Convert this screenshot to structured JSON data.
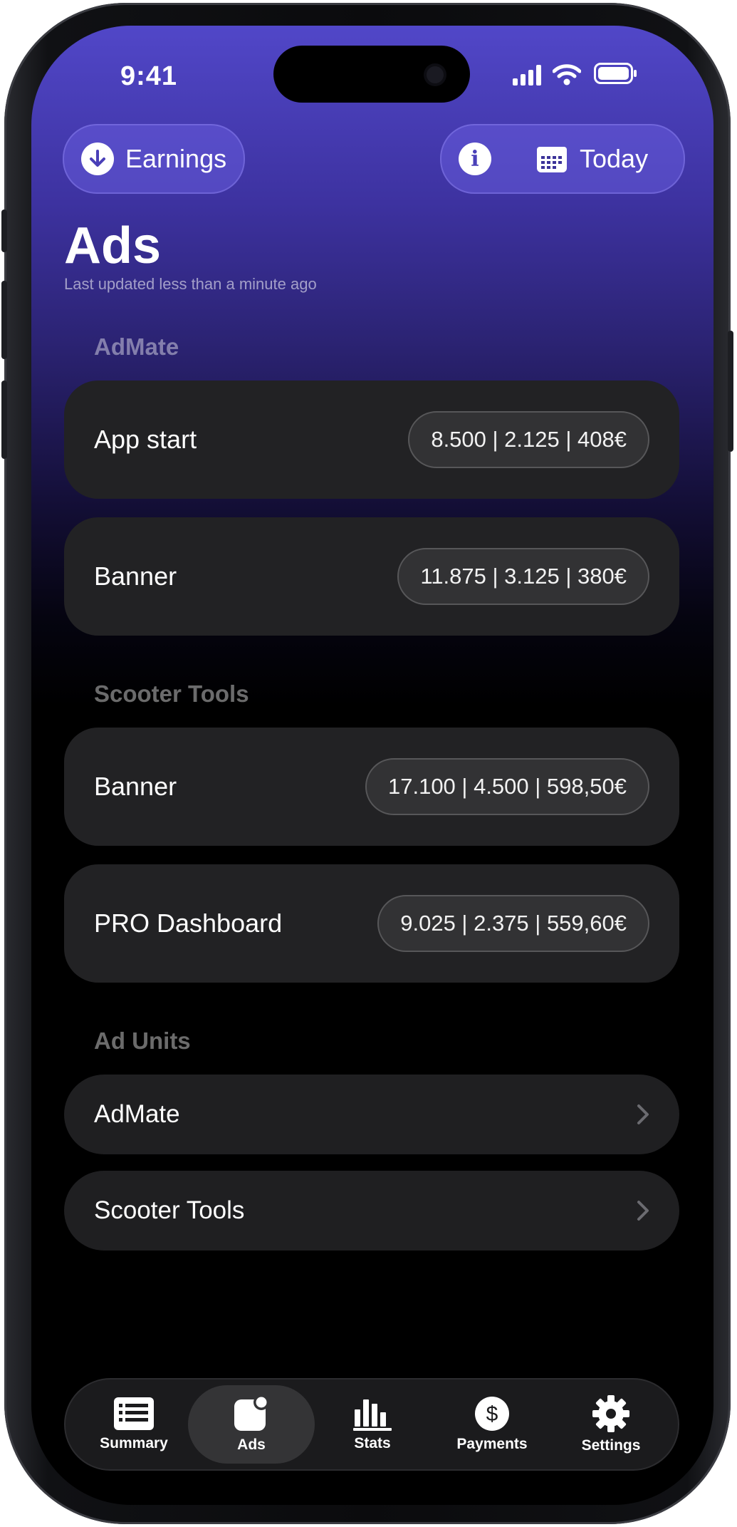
{
  "status": {
    "time": "9:41"
  },
  "header": {
    "earnings_label": "Earnings",
    "today_label": "Today",
    "info_icon": "info-icon",
    "calendar_icon": "calendar-icon",
    "download_icon": "arrow-down-circle-icon"
  },
  "page": {
    "title": "Ads",
    "subtitle": "Last updated less than a minute ago"
  },
  "sections": [
    {
      "title": "AdMate",
      "items": [
        {
          "label": "App start",
          "stats": "8.500 | 2.125 | 408€"
        },
        {
          "label": "Banner",
          "stats": "11.875 | 3.125 | 380€"
        }
      ]
    },
    {
      "title": "Scooter Tools",
      "items": [
        {
          "label": "Banner",
          "stats": "17.100 | 4.500 | 598,50€"
        },
        {
          "label": "PRO Dashboard",
          "stats": "9.025 | 2.375 | 559,60€"
        }
      ]
    }
  ],
  "ad_units": {
    "title": "Ad Units",
    "items": [
      {
        "label": "AdMate"
      },
      {
        "label": "Scooter Tools"
      }
    ]
  },
  "tabs": [
    {
      "label": "Summary",
      "icon": "list-icon"
    },
    {
      "label": "Ads",
      "icon": "ads-badge-icon",
      "active": true
    },
    {
      "label": "Stats",
      "icon": "bar-chart-icon"
    },
    {
      "label": "Payments",
      "icon": "dollar-circle-icon"
    },
    {
      "label": "Settings",
      "icon": "gear-icon"
    }
  ],
  "colors": {
    "accent_top": "#5147c8",
    "card": "#222224",
    "pill": "#323234",
    "background": "#000000"
  }
}
